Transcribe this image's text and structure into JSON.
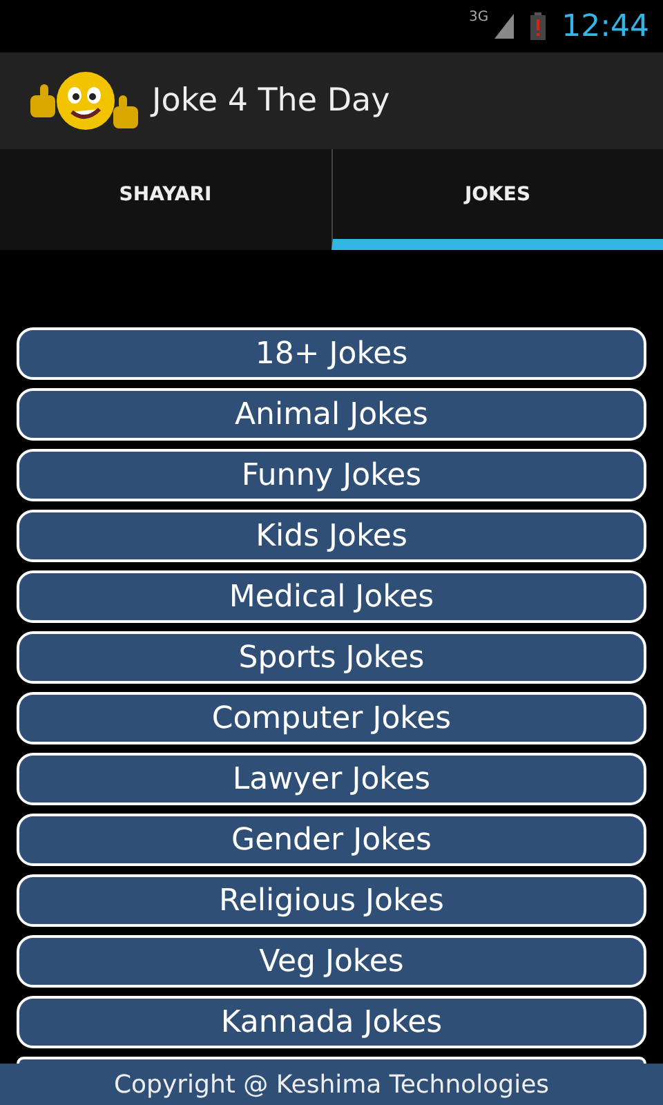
{
  "status_bar": {
    "network": "3G",
    "time": "12:44"
  },
  "action_bar": {
    "title": "Joke 4 The Day"
  },
  "tabs": [
    {
      "label": "SHAYARI",
      "selected": false
    },
    {
      "label": "JOKES",
      "selected": true
    }
  ],
  "categories": [
    "18+ Jokes",
    "Animal Jokes",
    "Funny Jokes",
    "Kids Jokes",
    "Medical Jokes",
    "Sports Jokes",
    "Computer Jokes",
    "Lawyer Jokes",
    "Gender Jokes",
    "Religious Jokes",
    "Veg Jokes",
    "Kannada Jokes"
  ],
  "footer": "Copyright @ Keshima Technologies"
}
